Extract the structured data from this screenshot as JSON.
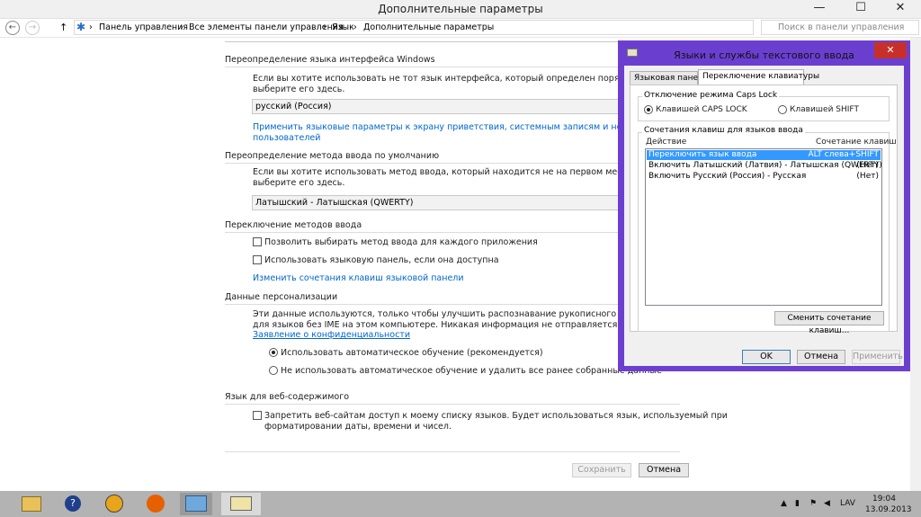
{
  "window": {
    "title": "Дополнительные параметры",
    "minimize": "—",
    "maximize": "☐",
    "close": "✕"
  },
  "nav": {
    "back": "←",
    "forward": "→",
    "up": "↑",
    "breadcrumb": [
      "Панель управления",
      "Все элементы панели управления",
      "Язык",
      "Дополнительные параметры"
    ],
    "separator": "›",
    "search_placeholder": "Поиск в панели управления"
  },
  "main": {
    "ui_override": {
      "heading": "Переопределение языка интерфейса Windows",
      "desc1": "Если вы хотите использовать не тот язык интерфейса, который определен порядком в вашем списке",
      "desc2": "выберите его здесь.",
      "combo": "русский (Россия)",
      "link1": "Применить языковые параметры к экрану приветствия, системным записям и новым учетным записям",
      "link2": "пользователей"
    },
    "input_override": {
      "heading": "Переопределение метода ввода по умолчанию",
      "desc1": "Если вы хотите использовать метод ввода, который находится не на первом месте в вашем списке",
      "desc2": "выберите его здесь.",
      "combo": "Латышский - Латышская (QWERTY)"
    },
    "switching": {
      "heading": "Переключение методов ввода",
      "check1": "Позволить выбирать метод ввода для каждого приложения",
      "check2": "Использовать языковую панель, если она доступна",
      "link": "Изменить сочетания клавиш языковой панели"
    },
    "personalization": {
      "heading": "Данные персонализации",
      "desc1": "Эти данные используются, только чтобы улучшить распознавание рукописного ввода и прогнозирование",
      "desc2": "для языков без IME на этом компьютере. Никакая информация не отправляется в корпорацию Майкрософт",
      "link": "Заявление о конфиденциальности",
      "radio1": "Использовать автоматическое обучение (рекомендуется)",
      "radio2": "Не использовать автоматическое обучение и удалить все ранее собранные данные"
    },
    "web": {
      "heading": "Язык для веб-содержимого",
      "check1": "Запретить веб-сайтам доступ к моему списку языков. Будет использоваться язык, используемый при",
      "check2": "форматировании даты, времени и чисел."
    },
    "save": "Сохранить",
    "cancel": "Отмена"
  },
  "dialog": {
    "title": "Языки и службы текстового ввода",
    "close": "✕",
    "tabs": [
      "Языковая панель",
      "Переключение клавиатуры"
    ],
    "capslock": {
      "label": "Отключение режима Caps Lock",
      "opt1": "Клавишей CAPS LOCK",
      "opt2": "Клавишей SHIFT"
    },
    "hotkeys": {
      "label": "Сочетания клавиш для языков ввода",
      "col_action": "Действие",
      "col_keys": "Сочетание клавиш",
      "rows": [
        {
          "action": "Переключить язык ввода",
          "keys": "ALT слева+SHIFT"
        },
        {
          "action": "Включить Латышский (Латвия) - Латышская (QWERTY)",
          "keys": "(Нет)"
        },
        {
          "action": "Включить Русский (Россия) - Русская",
          "keys": "(Нет)"
        }
      ],
      "change_btn": "Сменить сочетание клавиш..."
    },
    "ok": "OK",
    "cancel": "Отмена",
    "apply": "Применить"
  },
  "taskbar": {
    "lang": "LAV",
    "time": "19:04",
    "date": "13.09.2013"
  }
}
